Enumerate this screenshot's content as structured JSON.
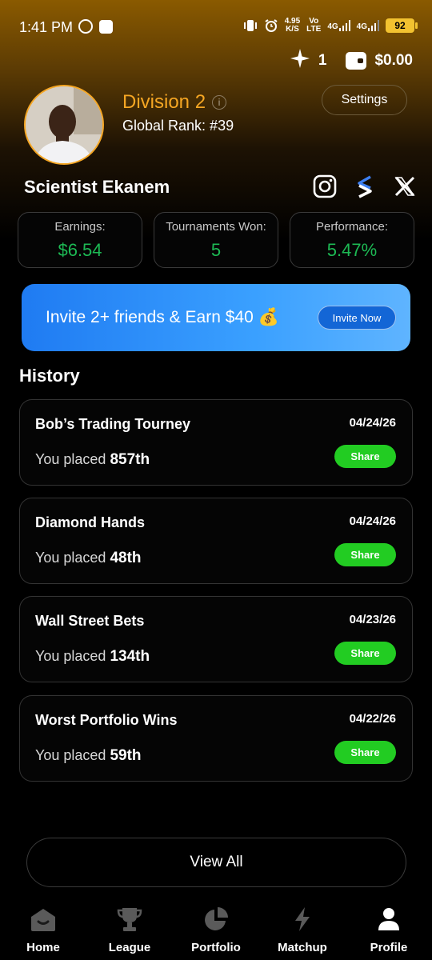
{
  "status_bar": {
    "time": "1:41 PM",
    "speed_top": "4.95",
    "speed_bottom": "K/S",
    "network_1_top": "Vo",
    "network_1_bottom": "LTE",
    "network_2": "4G",
    "network_3": "4G",
    "battery": "92"
  },
  "wallet": {
    "sparkle_count": "1",
    "balance": "$0.00"
  },
  "profile": {
    "division": "Division 2",
    "info_icon_glyph": "i",
    "global_rank": "Global Rank: #39",
    "settings_label": "Settings",
    "name": "Scientist  Ekanem",
    "accent_color": "#f5a623"
  },
  "stats": [
    {
      "label": "Earnings:",
      "value": "$6.54"
    },
    {
      "label": "Tournaments Won:",
      "value": "5"
    },
    {
      "label": "Performance:",
      "value": "5.47%"
    }
  ],
  "invite": {
    "text": "Invite 2+ friends & Earn $40 💰",
    "button": "Invite Now"
  },
  "history": {
    "title": "History",
    "place_prefix": "You placed",
    "share_label": "Share",
    "items": [
      {
        "title": "Bob’s Trading Tourney",
        "date": "04/24/26",
        "place": "857th"
      },
      {
        "title": "Diamond Hands",
        "date": "04/24/26",
        "place": "48th"
      },
      {
        "title": "Wall Street Bets",
        "date": "04/23/26",
        "place": "134th"
      },
      {
        "title": "Worst Portfolio Wins",
        "date": "04/22/26",
        "place": "59th"
      }
    ],
    "view_all": "View All"
  },
  "nav": [
    {
      "label": "Home",
      "icon": "home-icon"
    },
    {
      "label": "League",
      "icon": "trophy-icon"
    },
    {
      "label": "Portfolio",
      "icon": "pie-chart-icon"
    },
    {
      "label": "Matchup",
      "icon": "lightning-icon"
    },
    {
      "label": "Profile",
      "icon": "person-icon",
      "active": true
    }
  ],
  "colors": {
    "gain_green": "#1db954",
    "share_green": "#22cc22",
    "invite_blue": "#1f7bf2"
  }
}
